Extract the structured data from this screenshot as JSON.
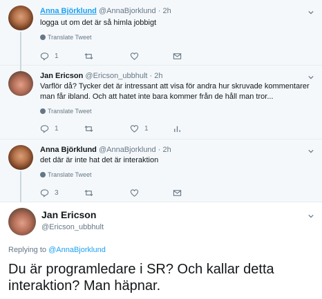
{
  "tweets": [
    {
      "name": "Anna Björklund",
      "handle": "@AnnaBjorklund",
      "time": "· 2h",
      "text": "logga ut om det är så himla jobbigt",
      "translate": "Translate Tweet",
      "replies": "1",
      "retweets": "",
      "likes": ""
    },
    {
      "name": "Jan Ericson",
      "handle": "@Ericson_ubbhult",
      "time": "· 2h",
      "text": "Varflör då? Tycker det är intressant att visa för andra hur skruvade kommentarer man får ibland. Och att hatet inte bara kommer från de håll man tror...",
      "translate": "Translate Tweet",
      "replies": "1",
      "retweets": "",
      "likes": "1"
    },
    {
      "name": "Anna Björklund",
      "handle": "@AnnaBjorklund",
      "time": "· 2h",
      "text": "det där är inte hat det är interaktion",
      "translate": "Translate Tweet",
      "replies": "3",
      "retweets": "",
      "likes": ""
    }
  ],
  "main": {
    "name": "Jan Ericson",
    "handle": "@Ericson_ubbhult",
    "replying_prefix": "Replying to",
    "replying_to": "@AnnaBjorklund",
    "text": "Du är programledare i SR? Och kallar detta interaktion? Man häpnar."
  },
  "colors": {
    "link": "#1da1f2",
    "secondary": "#657786",
    "background_thread": "#f5f8fa"
  }
}
